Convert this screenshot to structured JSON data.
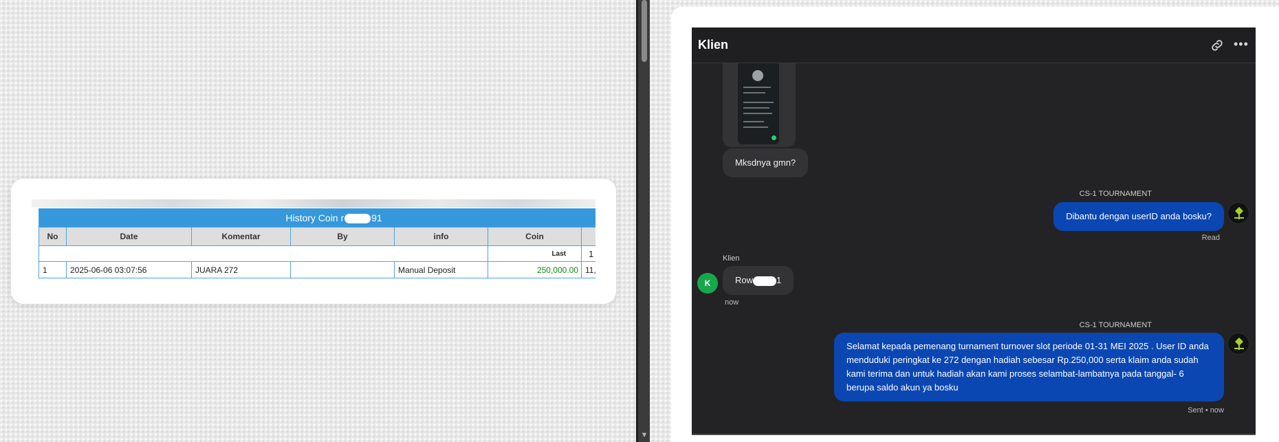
{
  "coin_history": {
    "title_prefix": "History Coin r",
    "title_suffix": "91",
    "columns": [
      "No",
      "Date",
      "Komentar",
      "By",
      "info",
      "Coin",
      ""
    ],
    "sub_row": {
      "coin_label": "Last",
      "edge_value": "1"
    },
    "rows": [
      {
        "no": "1",
        "date": "2025-06-06 03:07:56",
        "komentar": "JUARA 272",
        "by": "",
        "info": "Manual Deposit",
        "coin": "250,000.00",
        "next": "11,"
      }
    ]
  },
  "chat": {
    "title": "Klien",
    "messages": {
      "m1": {
        "text": "Mksdnya gmn?"
      },
      "m2": {
        "sender": "CS-1 TOURNAMENT",
        "text": "Dibantu dengan userID anda bosku?",
        "status": "Read"
      },
      "m3": {
        "sender": "Klien",
        "avatar_letter": "K",
        "text_prefix": "Row",
        "text_suffix": "1",
        "time": "now"
      },
      "m4": {
        "sender": "CS-1 TOURNAMENT",
        "text": "Selamat kepada pemenang turnament turnover slot periode 01-31 MEI 2025 . User ID anda menduduki peringkat ke 272 dengan hadiah sebesar Rp.250,000 serta klaim anda sudah kami terima dan untuk hadiah akan kami proses selambat-lambatnya pada tanggal- 6 berupa saldo akun ya bosku",
        "status": "Sent • now"
      }
    }
  },
  "icons": {
    "header": [
      "link-icon",
      "more-options-icon"
    ],
    "scrollbar": [
      "scroll-down-arrow-icon"
    ]
  },
  "colors": {
    "table_header_blue": "#3598db",
    "chat_bg": "#232325",
    "outgoing_bubble": "#0b47b3",
    "avatar_green": "#17a84b",
    "coin_green": "#118a11"
  }
}
